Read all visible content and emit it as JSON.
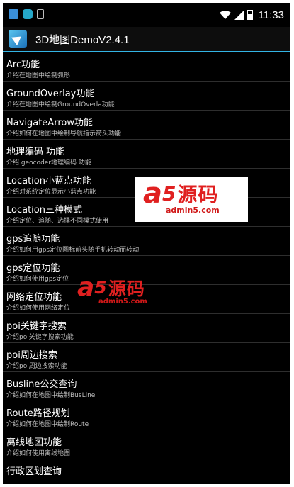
{
  "status_bar": {
    "time": "11:33",
    "icons": [
      "message-icon",
      "app-notification-icon",
      "sd-card-icon",
      "wifi-icon",
      "signal-icon",
      "battery-icon"
    ]
  },
  "action_bar": {
    "title": "3D地图DemoV2.4.1",
    "accent_color": "#33b5e5"
  },
  "list_items": [
    {
      "title": "Arc功能",
      "desc": "介绍在地图中绘制弧形"
    },
    {
      "title": "GroundOverlay功能",
      "desc": "介绍在地图中绘制GroundOverla功能"
    },
    {
      "title": "NavigateArrow功能",
      "desc": "介绍如何在地图中绘制导航指示箭头功能"
    },
    {
      "title": "地理编码 功能",
      "desc": "介绍 geocoder地理编码 功能"
    },
    {
      "title": "Location小蓝点功能",
      "desc": "介绍对系统定位显示小蓝点功能"
    },
    {
      "title": "Location三种模式",
      "desc": "介绍定位、追随、选择不同模式使用"
    },
    {
      "title": "gps追随功能",
      "desc": "介绍如何用gps定位图标前头随手机转动而转动"
    },
    {
      "title": "gps定位功能",
      "desc": "介绍如何使用gps定位"
    },
    {
      "title": "网络定位功能",
      "desc": "介绍如何使用网络定位"
    },
    {
      "title": "poi关键字搜索",
      "desc": "介绍poi关键字搜索功能"
    },
    {
      "title": "poi周边搜索",
      "desc": "介绍poi周边搜索功能"
    },
    {
      "title": "Busline公交查询",
      "desc": "介绍如何在地图中绘制BusLine"
    },
    {
      "title": "Route路径规划",
      "desc": "介绍如何在地图中绘制Route"
    },
    {
      "title": "离线地图功能",
      "desc": "介绍如何使用离线地图"
    },
    {
      "title": "行政区划查询",
      "desc": ""
    }
  ],
  "watermarks": [
    {
      "logo": "a",
      "num": "5",
      "cn": "源码",
      "url": "admin5.com"
    },
    {
      "logo": "a",
      "num": "5",
      "cn": "源码",
      "url": "admin5.com"
    }
  ]
}
